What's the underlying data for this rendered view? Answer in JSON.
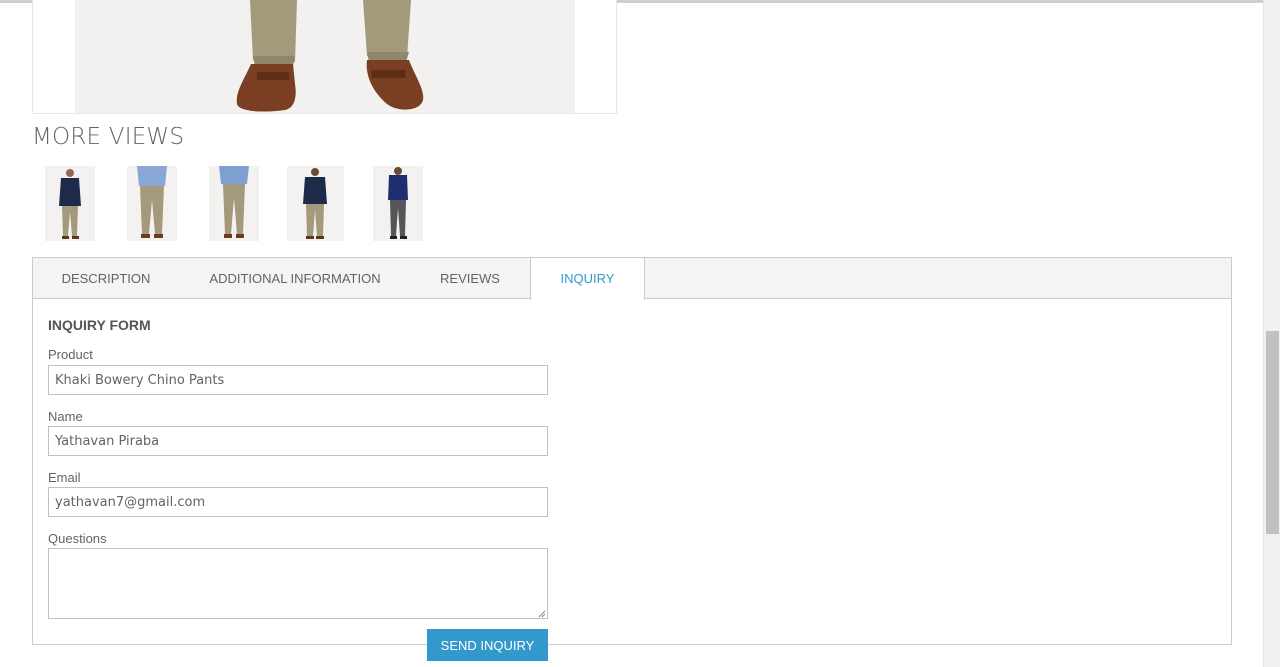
{
  "product_gallery": {
    "main_image_alt": "Khaki Bowery Chino Pants",
    "more_views_title": "MORE VIEWS",
    "thumbnails": [
      {
        "name": "navy-blazer-khaki-view"
      },
      {
        "name": "blue-check-shirt-khaki-view"
      },
      {
        "name": "blue-check-shirt-khaki-side-view"
      },
      {
        "name": "navy-blazer-khaki-back-view"
      },
      {
        "name": "navy-shirt-gray-pants-view"
      }
    ]
  },
  "tabs": [
    {
      "label": "DESCRIPTION",
      "active": false
    },
    {
      "label": "ADDITIONAL INFORMATION",
      "active": false
    },
    {
      "label": "REVIEWS",
      "active": false
    },
    {
      "label": "INQUIRY",
      "active": true
    }
  ],
  "inquiry_form": {
    "title": "INQUIRY FORM",
    "product_label": "Product",
    "product_value": "Khaki Bowery Chino Pants",
    "name_label": "Name",
    "name_value": "Yathavan Piraba",
    "email_label": "Email",
    "email_value": "yathavan7@gmail.com",
    "questions_label": "Questions",
    "questions_value": "",
    "submit_label": "SEND INQUIRY"
  },
  "colors": {
    "accent": "#3399cc",
    "text": "#636363",
    "tab_bar_bg": "#f4f4f4",
    "border": "#cccccc"
  }
}
